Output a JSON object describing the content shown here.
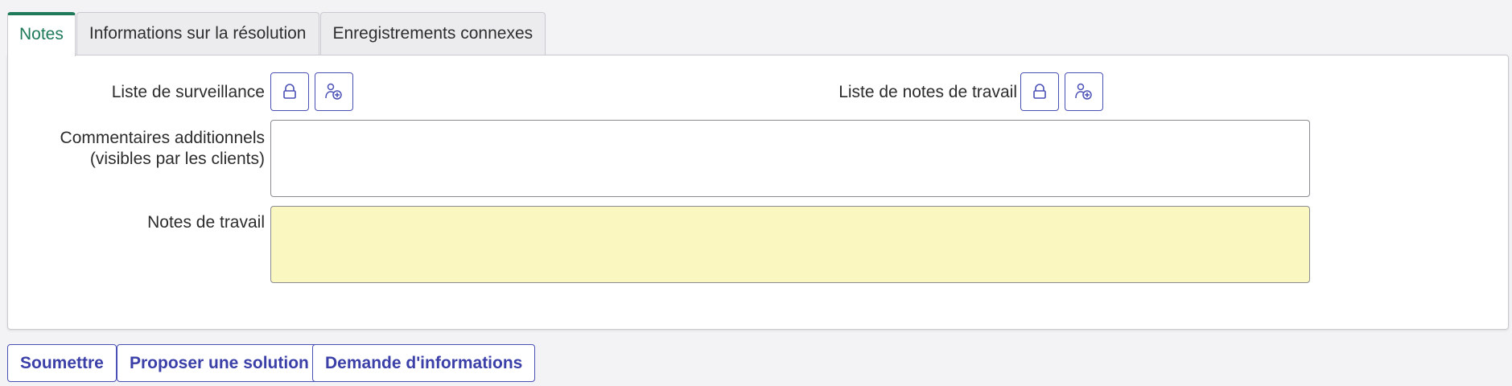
{
  "tabs": [
    {
      "label": "Notes",
      "active": true
    },
    {
      "label": "Informations sur la résolution",
      "active": false
    },
    {
      "label": "Enregistrements connexes",
      "active": false
    }
  ],
  "form": {
    "watch_list_label": "Liste de surveillance",
    "work_notes_list_label": "Liste de notes de travail",
    "comments_label_line1": "Commentaires additionnels",
    "comments_label_line2": "(visibles par les clients)",
    "comments_value": "",
    "work_notes_label": "Notes de travail",
    "work_notes_value": ""
  },
  "icons": {
    "lock": "lock-icon",
    "add_user": "add-user-icon"
  },
  "actions": {
    "submit_label": "Soumettre",
    "propose_label": "Proposer une solution",
    "request_info_label": "Demande d'informations"
  },
  "colors": {
    "accent_green": "#1e7a58",
    "button_blue": "#3b3fa8",
    "work_notes_bg": "#faf7c0"
  }
}
